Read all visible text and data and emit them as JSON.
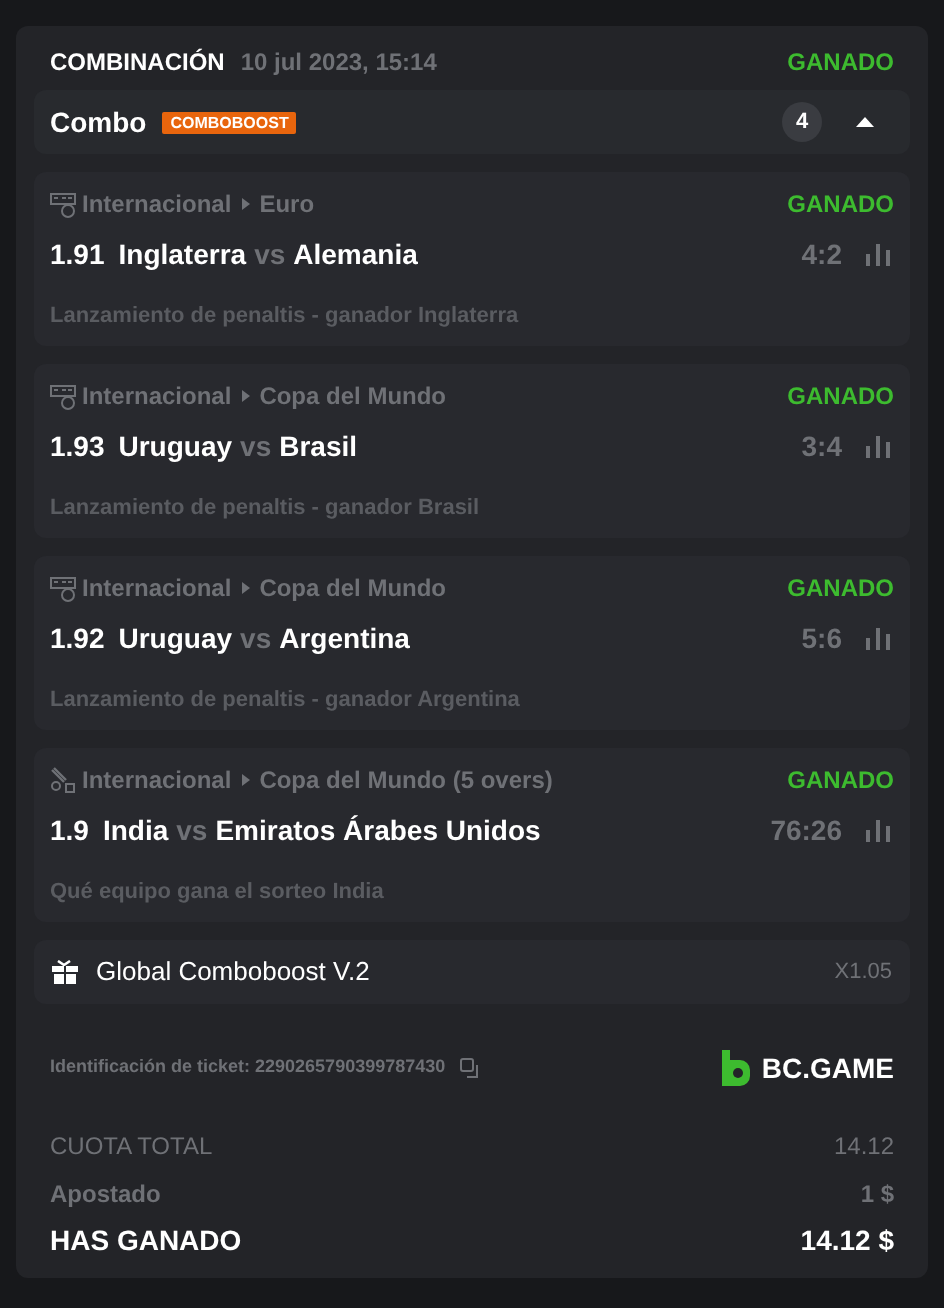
{
  "header": {
    "type": "COMBINACIÓN",
    "date": "10 jul 2023, 15:14",
    "status": "GANADO"
  },
  "combo": {
    "title": "Combo",
    "badge": "COMBOBOOST",
    "count": "4",
    "expanded": true
  },
  "selections": [
    {
      "kind": "penalty",
      "league": "Internacional",
      "tournament": "Euro",
      "status": "GANADO",
      "odds": "1.91",
      "home": "Inglaterra",
      "vs": "vs",
      "away": "Alemania",
      "score": "4:2",
      "market": "Lanzamiento de penaltis - ganador Inglaterra"
    },
    {
      "kind": "penalty",
      "league": "Internacional",
      "tournament": "Copa del Mundo",
      "status": "GANADO",
      "odds": "1.93",
      "home": "Uruguay",
      "vs": "vs",
      "away": "Brasil",
      "score": "3:4",
      "market": "Lanzamiento de penaltis - ganador Brasil"
    },
    {
      "kind": "penalty",
      "league": "Internacional",
      "tournament": "Copa del Mundo",
      "status": "GANADO",
      "odds": "1.92",
      "home": "Uruguay",
      "vs": "vs",
      "away": "Argentina",
      "score": "5:6",
      "market": "Lanzamiento de penaltis - ganador Argentina"
    },
    {
      "kind": "cricket",
      "league": "Internacional",
      "tournament": "Copa del Mundo (5 overs)",
      "status": "GANADO",
      "odds": "1.9",
      "home": "India",
      "vs": "vs",
      "away": "Emiratos Árabes Unidos",
      "score": "76:26",
      "market": "Qué equipo gana el sorteo India"
    }
  ],
  "boost": {
    "label": "Global Comboboost V.2",
    "value": "X1.05"
  },
  "ticket": {
    "label": "Identificación de ticket: 2290265790399787430",
    "brand": "BC.GAME"
  },
  "totals": [
    {
      "kind": "muted",
      "label": "CUOTA TOTAL",
      "value": "14.12"
    },
    {
      "kind": "semi",
      "label": "Apostado",
      "value": "1 $"
    },
    {
      "kind": "strong",
      "label": "HAS GANADO",
      "value": "14.12 $"
    }
  ]
}
